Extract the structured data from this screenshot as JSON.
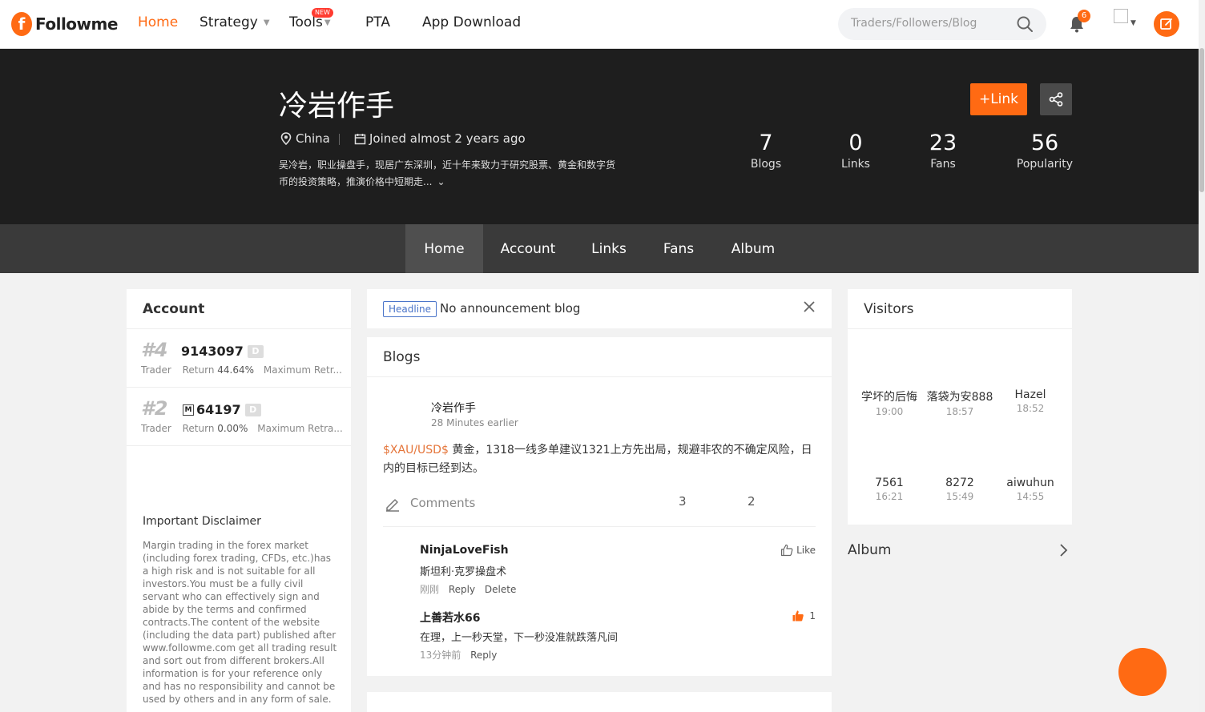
{
  "brand": {
    "logo_mark": "f",
    "logo_text": "Followme"
  },
  "nav": {
    "items": [
      {
        "label": "Home"
      },
      {
        "label": "Strategy"
      },
      {
        "label": "Tools",
        "badge": "NEW"
      },
      {
        "label": "PTA"
      },
      {
        "label": "App Download"
      }
    ],
    "search_placeholder": "Traders/Followers/Blog",
    "notification_count": "6"
  },
  "profile": {
    "name": "冷岩作手",
    "location": "China",
    "joined": "Joined almost 2 years ago",
    "bio": "吴冷岩，职业操盘手，现居广东深圳，近十年来致力于研究股票、黄金和数字货币的投资策略，推演价格中短期走...",
    "link_label": "+Link",
    "stats": [
      {
        "value": "7",
        "label": "Blogs"
      },
      {
        "value": "0",
        "label": "Links"
      },
      {
        "value": "23",
        "label": "Fans"
      },
      {
        "value": "56",
        "label": "Popularity"
      }
    ]
  },
  "tabs": [
    {
      "label": "Home"
    },
    {
      "label": "Account"
    },
    {
      "label": "Links"
    },
    {
      "label": "Fans"
    },
    {
      "label": "Album"
    }
  ],
  "account_card": {
    "title": "Account",
    "accounts": [
      {
        "rank": "#4",
        "number": "9143097",
        "badge": "D",
        "role": "Trader",
        "return_label": "Return",
        "return_value": "44.64%",
        "extra": "Maximum Retr..."
      },
      {
        "rank": "#2",
        "number": "64197",
        "badge": "D",
        "mt_badge": "M",
        "role": "Trader",
        "return_label": "Return",
        "return_value": "0.00%",
        "extra": "Maximum Retra..."
      }
    ],
    "disclaimer_title": "Important Disclaimer",
    "disclaimer_text": "Margin trading in the forex market (including forex trading, CFDs, etc.)has a high risk and is not suitable for all investors.You must be a fully civil servant who can effectively sign and abide by the terms and confirmed contracts.The content of the website (including the data part) published after www.followme.com get all trading result and sort out from different brokers.All information is for your reference only and has no responsibility and cannot be used by others and in any form of sale."
  },
  "headline": {
    "tag": "Headline",
    "text": "No announcement blog"
  },
  "blogs": {
    "title": "Blogs",
    "post": {
      "author": "冷岩作手",
      "time": "28 Minutes earlier",
      "tag": "$XAU/USD$",
      "body": " 黄金，1318一线多单建议1321上方先出局，规避非农的不确定风险，日内的目标已经到达。",
      "comments_label": "Comments",
      "count_a": "3",
      "count_b": "2"
    },
    "comments": [
      {
        "name": "NinjaLoveFish",
        "text": "斯坦利·克罗操盘术",
        "time": "刚刚",
        "reply": "Reply",
        "delete": "Delete",
        "like": "Like"
      },
      {
        "name": "上善若水66",
        "text": "在理，上一秒天堂，下一秒没准就跌落凡间",
        "time": "13分钟前",
        "reply": "Reply",
        "like": "1"
      }
    ]
  },
  "visitors": {
    "title": "Visitors",
    "list": [
      {
        "name": "学坏的后悔",
        "time": "19:00"
      },
      {
        "name": "落袋为安888",
        "time": "18:57"
      },
      {
        "name": "Hazel",
        "time": "18:52"
      },
      {
        "name": "7561",
        "time": "16:21"
      },
      {
        "name": "8272",
        "time": "15:49"
      },
      {
        "name": "aiwuhun",
        "time": "14:55"
      }
    ]
  },
  "album": {
    "title": "Album"
  },
  "colors": {
    "accent": "#ff6a13",
    "hero_bg": "#1e1e1e",
    "tab_bg": "#3a3a3a",
    "headline_blue": "#4a74c9"
  }
}
